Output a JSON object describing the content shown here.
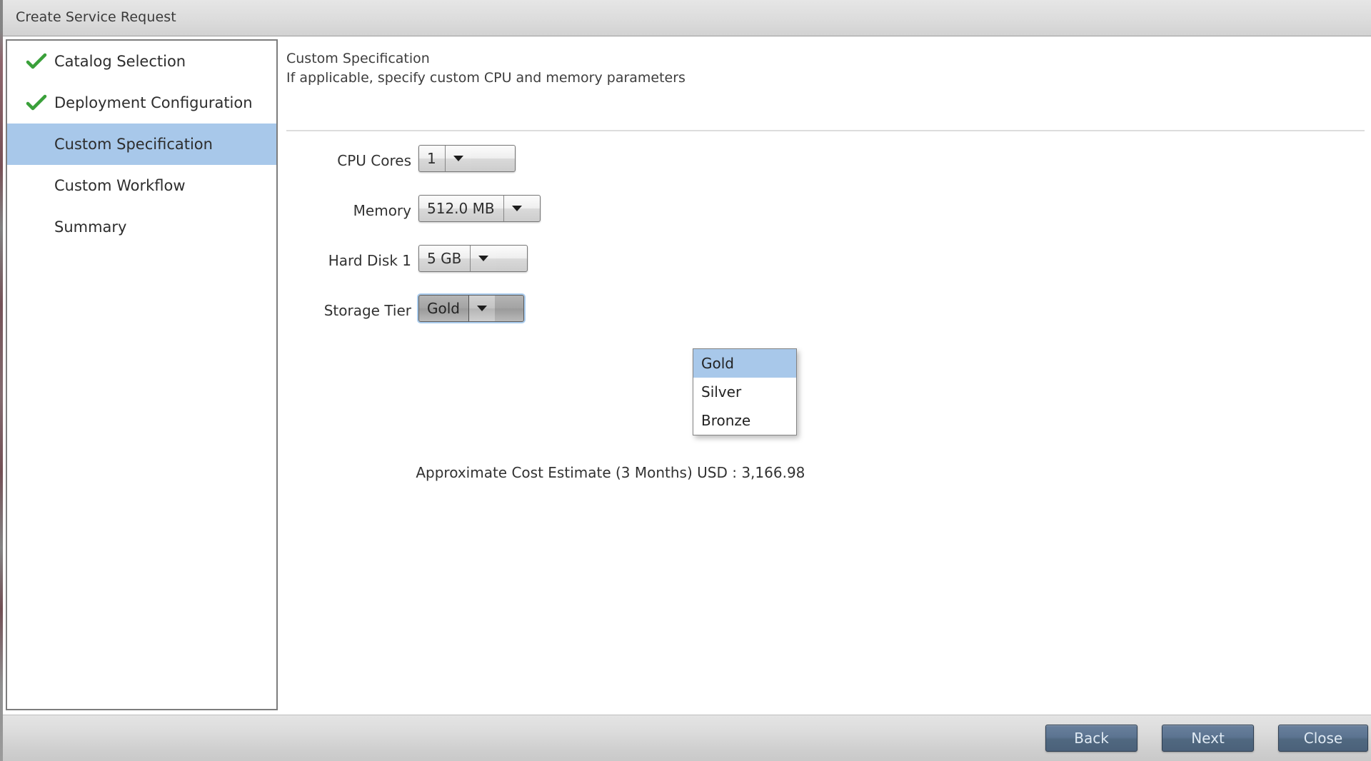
{
  "window": {
    "title": "Create Service Request",
    "accent_color": "#a8c8ea",
    "button_color": "#5c7491",
    "check_color": "#3aa03a"
  },
  "sidebar": {
    "items": [
      {
        "label": "Catalog Selection",
        "state": "done",
        "icon": "check-icon"
      },
      {
        "label": "Deployment Configuration",
        "state": "done",
        "icon": "check-icon"
      },
      {
        "label": "Custom Specification",
        "state": "selected",
        "icon": ""
      },
      {
        "label": "Custom Workflow",
        "state": "pending",
        "icon": ""
      },
      {
        "label": "Summary",
        "state": "pending",
        "icon": ""
      }
    ]
  },
  "main": {
    "header": {
      "title": "Custom Specification",
      "subtitle": "If applicable, specify custom CPU and memory parameters"
    },
    "fields": [
      {
        "label": "CPU Cores",
        "value": "1",
        "name": "cpu-cores"
      },
      {
        "label": "Memory",
        "value": "512.0 MB",
        "name": "memory"
      },
      {
        "label": "Hard Disk 1",
        "value": "5 GB",
        "name": "hard-disk-1"
      },
      {
        "label": "Storage Tier",
        "value": "Gold",
        "name": "storage-tier"
      }
    ],
    "dropdown": {
      "open": true,
      "options": [
        "Gold",
        "Silver",
        "Bronze"
      ],
      "selected": "Gold"
    },
    "cost": {
      "text": "Approximate Cost Estimate  (3 Months) USD :  3,166.98"
    }
  },
  "footer": {
    "buttons": [
      {
        "label": "Back",
        "name": "back-button"
      },
      {
        "label": "Next",
        "name": "next-button"
      },
      {
        "label": "Close",
        "name": "close-button"
      }
    ]
  }
}
